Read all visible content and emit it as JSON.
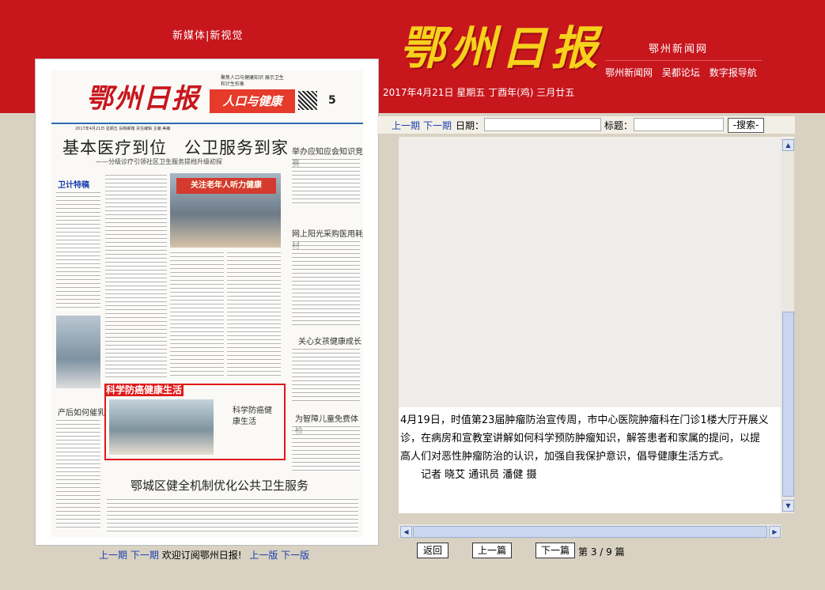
{
  "header": {
    "new_media": "新媒体|新视觉",
    "masthead": "鄂州日报",
    "site_name": "鄂州新闻网",
    "links": [
      "鄂州新闻网",
      "吴都论坛",
      "数字报导航"
    ],
    "date_line": "2017年4月21日 星期五 丁酉年(鸡) 三月廿五"
  },
  "newspaper_page": {
    "masthead": "鄂州日报",
    "section": "人口与健康",
    "section_note": "聚焦人口与健康知识 展示卫生和计生形象",
    "page_number": "5",
    "meta": "2017年4月21日  星期五    投稿邮箱    责任编辑    主编  美编",
    "headline": "基本医疗到位　公卫服务到家",
    "subheadline": "——分级诊疗引领社区卫生服务提档升级初探",
    "column_tag": "卫计特稿",
    "photo_banner": "关注老年人听力健康",
    "highlight_title": "科学防癌健康生活",
    "highlight_sub": "科学防癌健康生活",
    "side_heads": [
      "举办应知应会知识竞赛",
      "网上阳光采购医用耗材",
      "关心女孩健康成长",
      "为智障儿童免费体检"
    ],
    "left_head": "产后如何催乳",
    "bottom_headline": "鄂城区健全机制优化公共卫生服务"
  },
  "bottom_nav": {
    "prev_issue": "上一期",
    "next_issue": "下一期",
    "welcome": "欢迎订阅鄂州日报!",
    "prev_page": "上一版",
    "next_page": "下一版"
  },
  "search": {
    "prev_issue": "上一期",
    "next_issue": "下一期",
    "date_label": "日期：",
    "title_label": "标题：",
    "button": "-搜索-"
  },
  "article": {
    "lines": [
      "4月19日，时值第23届肿瘤防治宣传周，市中心医院肿瘤科在门诊1楼大厅开展义",
      "诊，在病房和宣教室讲解如何科学预防肿瘤知识，解答患者和家属的提问，以提",
      "高人们对恶性肿瘤防治的认识，加强自我保护意识，倡导健康生活方式。",
      "　　记者 晓艾 通讯员 潘健 摄"
    ]
  },
  "pager": {
    "back": "返回",
    "prev": "上一篇",
    "next": "下一篇",
    "position": "第 3 / 9 篇"
  },
  "colors": {
    "header_red": "#c8161d",
    "masthead_yellow": "#f6d21c",
    "link_blue": "#1a3fae",
    "highlight_red": "#e01818"
  }
}
